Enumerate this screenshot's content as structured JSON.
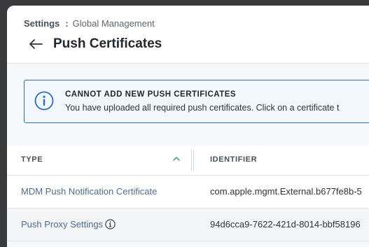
{
  "breadcrumb": {
    "root": "Settings",
    "separator": ":",
    "current": "Global Management"
  },
  "page": {
    "title": "Push Certificates"
  },
  "alert": {
    "title": "CANNOT ADD NEW PUSH CERTIFICATES",
    "message": "You have uploaded all required push certificates. Click on a certificate t"
  },
  "table": {
    "columns": {
      "type": "TYPE",
      "identifier": "IDENTIFIER"
    },
    "rows": [
      {
        "type": "MDM Push Notification Certificate",
        "identifier": "com.apple.mgmt.External.b677fe8b-5"
      },
      {
        "type": "Push Proxy Settings",
        "identifier": "94d6cca9-7622-421d-8014-bbf58196"
      }
    ]
  },
  "colors": {
    "accent": "#2b6fc0",
    "link": "#4f6d94",
    "sort_indicator": "#3aa35a"
  }
}
